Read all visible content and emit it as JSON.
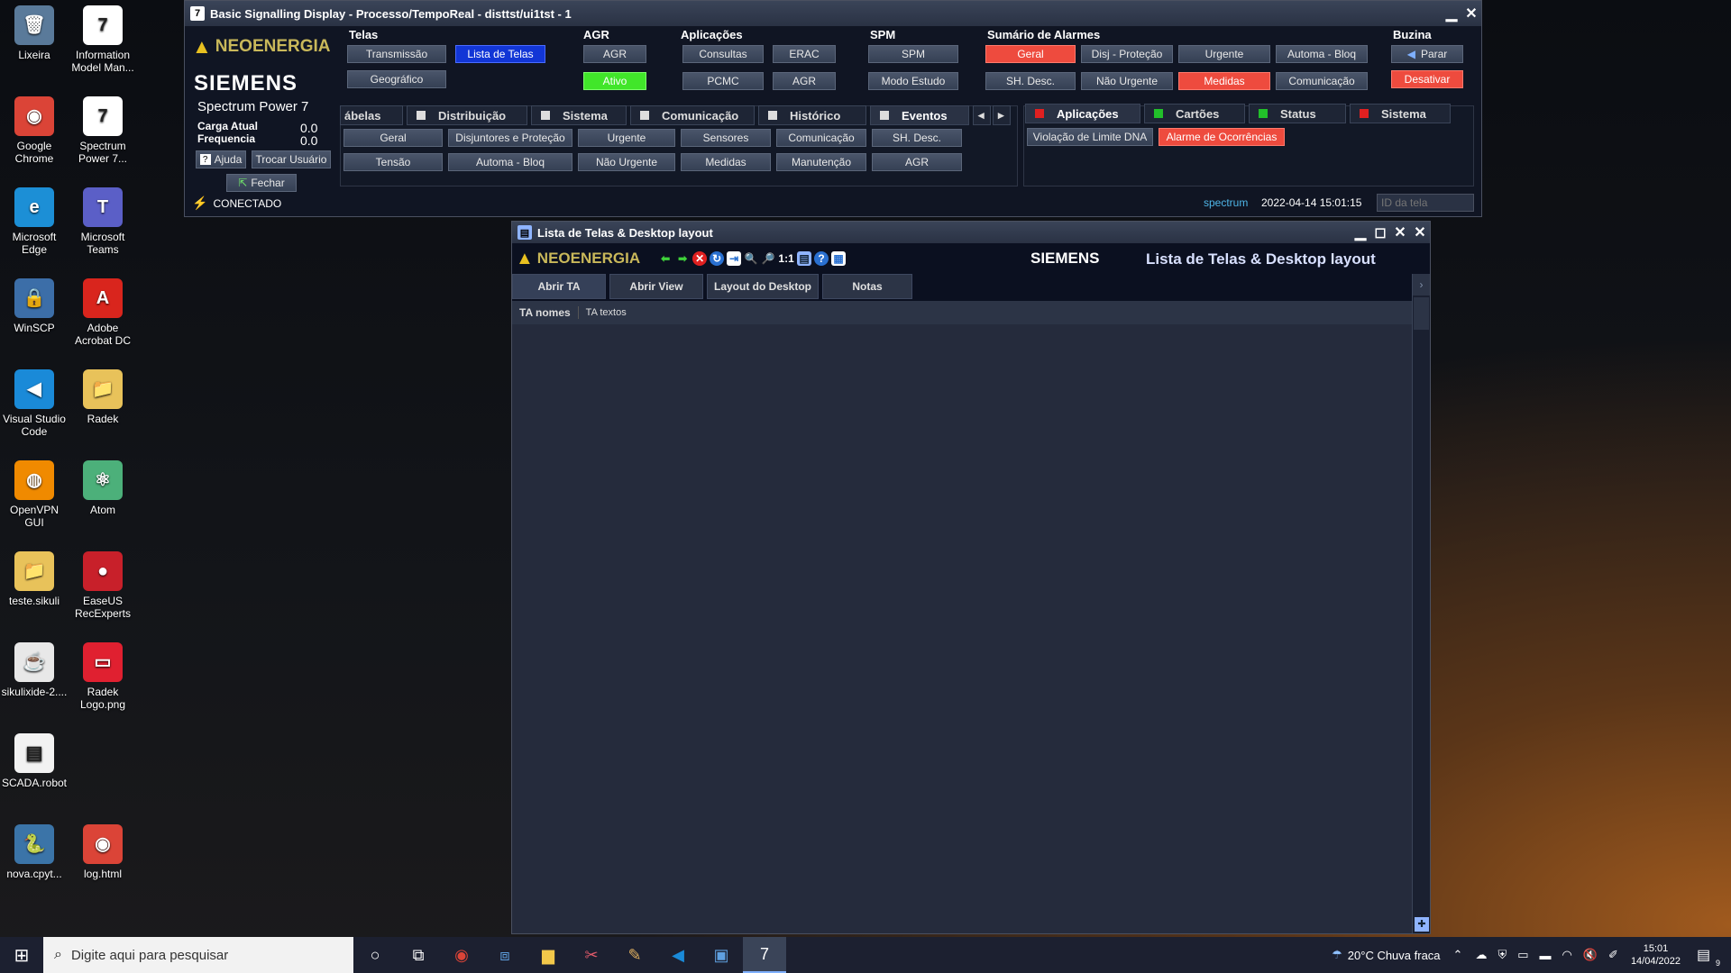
{
  "desktop": {
    "icons": [
      {
        "label": "Lixeira",
        "icon": "recycle-bin-icon",
        "glyph": "🗑",
        "color": "#5a7a9a"
      },
      {
        "label": "Information Model Man...",
        "icon": "spectrum-icon",
        "glyph": "7",
        "color": "#ffffff"
      },
      {
        "label": "Google Chrome",
        "icon": "chrome-icon",
        "glyph": "◉",
        "color": "#db4437"
      },
      {
        "label": "Spectrum Power 7...",
        "icon": "spectrum-icon",
        "glyph": "7",
        "color": "#ffffff"
      },
      {
        "label": "Microsoft Edge",
        "icon": "edge-icon",
        "glyph": "e",
        "color": "#1c8fd6"
      },
      {
        "label": "Microsoft Teams",
        "icon": "teams-icon",
        "glyph": "T",
        "color": "#5b5fc7"
      },
      {
        "label": "WinSCP",
        "icon": "winscp-icon",
        "glyph": "🔒",
        "color": "#3c6ea8"
      },
      {
        "label": "Adobe Acrobat DC",
        "icon": "acrobat-icon",
        "glyph": "A",
        "color": "#d9251d"
      },
      {
        "label": "Visual Studio Code",
        "icon": "vscode-icon",
        "glyph": "◀",
        "color": "#1a8ad8"
      },
      {
        "label": "Radek",
        "icon": "folder-icon",
        "glyph": "📁",
        "color": "#e8c25a"
      },
      {
        "label": "OpenVPN GUI",
        "icon": "openvpn-icon",
        "glyph": "◍",
        "color": "#f08a00"
      },
      {
        "label": "Atom",
        "icon": "atom-icon",
        "glyph": "⚛",
        "color": "#4cb07a"
      },
      {
        "label": "teste.sikuli",
        "icon": "folder-icon",
        "glyph": "📁",
        "color": "#e8c25a"
      },
      {
        "label": "EaseUS RecExperts",
        "icon": "recexperts-icon",
        "glyph": "●",
        "color": "#c8202a"
      },
      {
        "label": "sikulixide-2....",
        "icon": "java-icon",
        "glyph": "☕",
        "color": "#e8e8e8"
      },
      {
        "label": "Radek Logo.png",
        "icon": "image-icon",
        "glyph": "▭",
        "color": "#e02030"
      },
      {
        "label": "SCADA.robot",
        "icon": "document-icon",
        "glyph": "▤",
        "color": "#f2f2f2"
      },
      {
        "label": "nova.cpyt...",
        "icon": "python-icon",
        "glyph": "🐍",
        "color": "#3b74a8"
      },
      {
        "label": "log.html",
        "icon": "chrome-icon",
        "glyph": "◉",
        "color": "#db4437"
      }
    ]
  },
  "bsd": {
    "title": "Basic Signalling Display - Processo/TempoReal - disttst/ui1tst - 1",
    "brand": "NEOENERGIA",
    "vendor": "SIEMENS",
    "product": "Spectrum Power 7",
    "carga_label": "Carga Atual",
    "carga_value": "0.0",
    "freq_label": "Frequencia",
    "freq_value": "0.0",
    "ajuda": "Ajuda",
    "trocar": "Trocar Usuário",
    "fechar": "Fechar",
    "status": "CONECTADO",
    "telas": {
      "title": "Telas",
      "transmissao": "Transmissão",
      "lista": "Lista de Telas",
      "geografico": "Geográfico"
    },
    "agr": {
      "title": "AGR",
      "agr": "AGR",
      "ativo": "Ativo"
    },
    "aplicacoes": {
      "title": "Aplicações",
      "consultas": "Consultas",
      "erac": "ERAC",
      "pcmc": "PCMC",
      "agr": "AGR"
    },
    "spm": {
      "title": "SPM",
      "spm": "SPM",
      "modo": "Modo Estudo"
    },
    "alarmes": {
      "title": "Sumário de Alarmes",
      "geral": "Geral",
      "disj": "Disj - Proteção",
      "urgente": "Urgente",
      "automa": "Automa - Bloq",
      "sh": "SH. Desc.",
      "nao_urgente": "Não Urgente",
      "medidas": "Medidas",
      "comunicacao": "Comunicação"
    },
    "buzina": {
      "title": "Buzina",
      "parar": "Parar",
      "desativar": "Desativar"
    },
    "tabs": [
      "ábelas",
      "Distribuição",
      "Sistema",
      "Comunicação",
      "Histórico",
      "Eventos"
    ],
    "event_buttons": [
      "Geral",
      "Disjuntores e Proteção",
      "Urgente",
      "Sensores",
      "Comunicação",
      "SH. Desc.",
      "Tensão",
      "Automa - Bloq",
      "Não Urgente",
      "Medidas",
      "Manutenção",
      "AGR"
    ],
    "right_tabs": [
      "Aplicações",
      "Cartões",
      "Status",
      "Sistema"
    ],
    "violacao": "Violação de Limite DNA",
    "alarme_oc": "Alarme de Ocorrências",
    "user": "spectrum",
    "datetime": "2022-04-14 15:01:15",
    "id_placeholder": "ID da tela"
  },
  "lt": {
    "title": "Lista de Telas & Desktop layout",
    "brand": "NEOENERGIA",
    "vendor": "SIEMENS",
    "heading": "Lista de Telas & Desktop layout",
    "zoom_label": "1:1",
    "tabs": [
      "Abrir TA",
      "Abrir View",
      "Layout do Desktop",
      "Notas"
    ],
    "subtabs": [
      "TA nomes",
      "TA textos"
    ]
  },
  "taskbar": {
    "search_placeholder": "Digite aqui para pesquisar",
    "weather": "20°C  Chuva fraca",
    "time": "15:01",
    "date": "14/04/2022",
    "notif_count": "9"
  }
}
